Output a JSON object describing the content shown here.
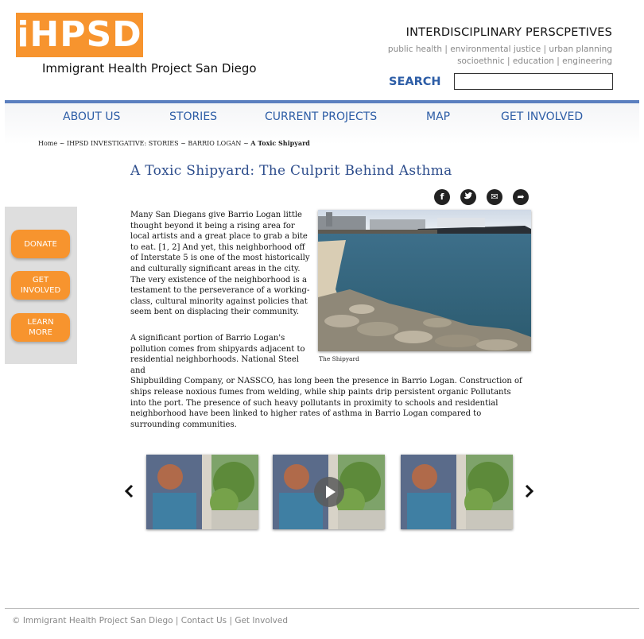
{
  "header": {
    "logo": "iHPSD",
    "org_name": "Immigrant Health Project San Diego",
    "tagline": "INTERDISCIPLINARY PERSCPETIVES",
    "topics_line1": "public health | environmental justice | urban planning",
    "topics_line2": "socioethnic | education | engineering",
    "search_label": "SEARCH",
    "search_value": "",
    "logo_color": "#f7942e"
  },
  "nav": {
    "items": [
      {
        "label": "ABOUT US"
      },
      {
        "label": "STORIES"
      },
      {
        "label": "CURRENT PROJECTS"
      },
      {
        "label": "MAP"
      },
      {
        "label": "GET INVOLVED"
      }
    ],
    "accent_color": "#2d5da6"
  },
  "breadcrumb": {
    "home": "Home",
    "sep": "~",
    "crumb2": "IHPSD INVESTIGATIVE: STORIES",
    "crumb3": "BARRIO LOGAN",
    "current": "A Toxic Shipyard"
  },
  "article": {
    "title": "A Toxic Shipyard: The Culprit Behind Asthma",
    "para1": "Many San Diegans give Barrio Logan little thought beyond it being a rising area for local artists and a great place to grab a bite to eat. [1, 2] And yet, this neighborhood off of Interstate 5 is one of the most historically and culturally significant areas in the city. The very existence of the neighborhood is a testament to the perseverance of a working-class, cultural minority against policies that seem bent on displacing their community.",
    "para2_narrow": "A significant portion of Barrio Logan's pollution comes from shipyards adjacent to residential neighborhoods. National Steel and",
    "para2_wide": "Shipbuilding Company, or NASSCO, has long been the presence in Barrio Logan. Construction of ships release noxious fumes from welding, while ship paints drip persistent organic Pollutants into the port. The presence of such heavy pollutants in proximity to schools and residential neighborhood have been linked to higher rates of asthma in Barrio Logan compared to surrounding communities.",
    "photo_caption": "The Shipyard"
  },
  "share": [
    {
      "icon": "facebook-icon",
      "glyph": "f"
    },
    {
      "icon": "twitter-icon",
      "glyph": "t"
    },
    {
      "icon": "email-icon",
      "glyph": "✉"
    },
    {
      "icon": "share-icon",
      "glyph": "➦"
    }
  ],
  "sidebar": {
    "donate": "DONATE",
    "get_involved_1": "GET",
    "get_involved_2": "INVOLVED",
    "learn_more_1": "LEARN",
    "learn_more_2": "MORE",
    "button_color": "#f7942e"
  },
  "carousel": {
    "prev_icon": "chevron-left-icon",
    "next_icon": "chevron-right-icon",
    "thumb_count": 3,
    "active_has_play": true
  },
  "footer": {
    "text": "© Immigrant Health Project San Diego | Contact Us | Get Involved"
  }
}
